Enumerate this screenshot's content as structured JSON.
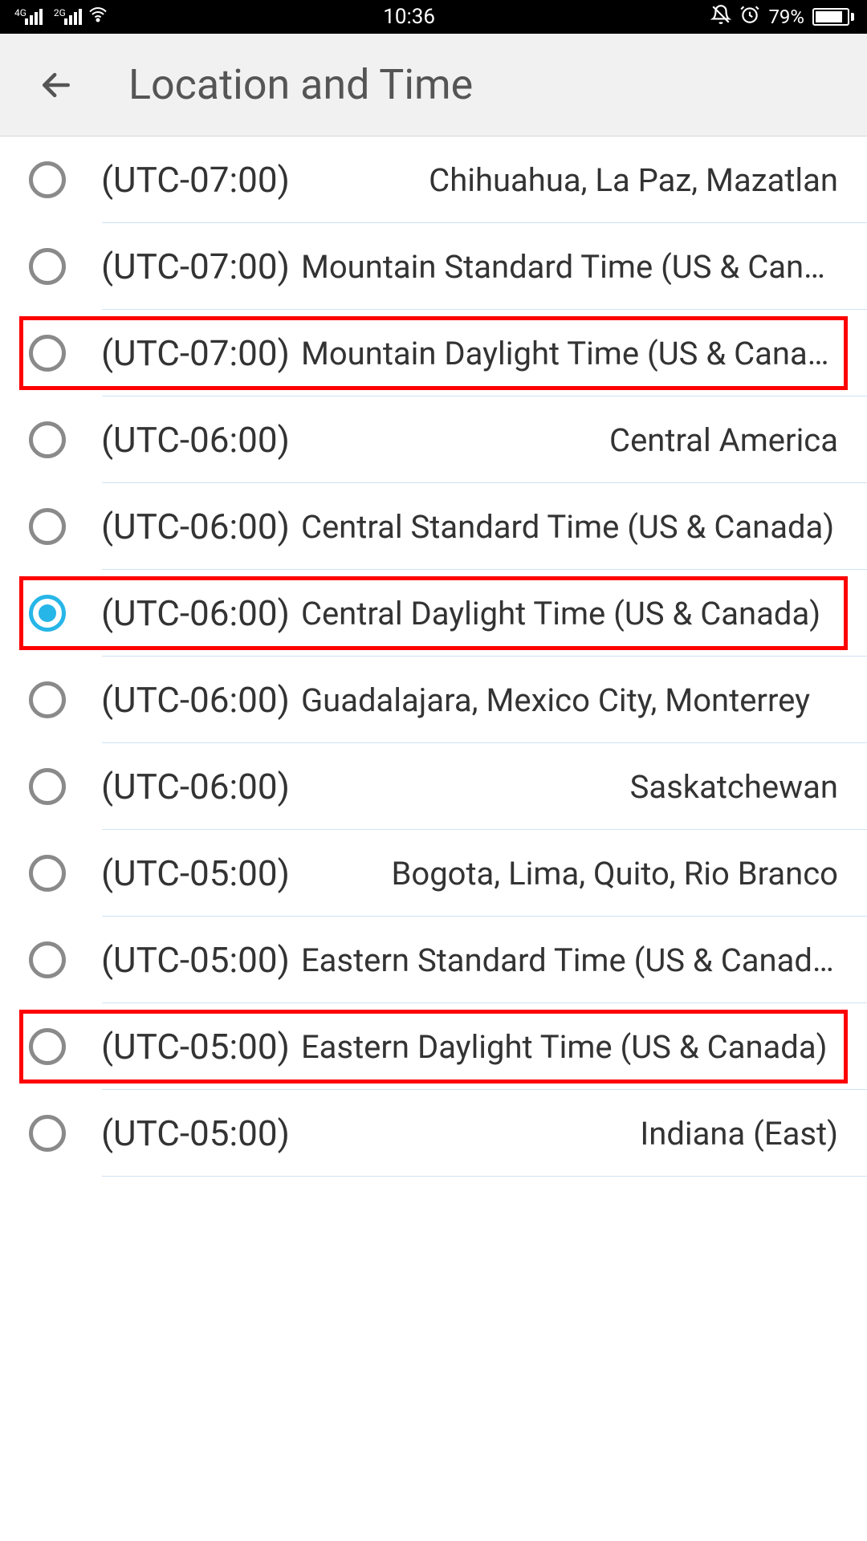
{
  "status_bar": {
    "signal1_label": "4G",
    "signal2_label": "2G",
    "time": "10:36",
    "battery_pct": "79%"
  },
  "header": {
    "title": "Location and Time"
  },
  "timezones": [
    {
      "offset": "(UTC-07:00)",
      "name": "Chihuahua, La Paz, Mazatlan",
      "selected": false,
      "long": false
    },
    {
      "offset": "(UTC-07:00)",
      "name": "Mountain Standard Time (US & Canada)",
      "selected": false,
      "long": true
    },
    {
      "offset": "(UTC-07:00)",
      "name": "Mountain Daylight Time (US & Canada)",
      "selected": false,
      "long": true,
      "highlighted": true
    },
    {
      "offset": "(UTC-06:00)",
      "name": "Central America",
      "selected": false,
      "long": false
    },
    {
      "offset": "(UTC-06:00)",
      "name": "Central Standard Time (US & Canada)",
      "selected": false,
      "long": true
    },
    {
      "offset": "(UTC-06:00)",
      "name": "Central Daylight Time (US & Canada)",
      "selected": true,
      "long": true,
      "highlighted": true
    },
    {
      "offset": "(UTC-06:00)",
      "name": "Guadalajara, Mexico City, Monterrey",
      "selected": false,
      "long": true
    },
    {
      "offset": "(UTC-06:00)",
      "name": "Saskatchewan",
      "selected": false,
      "long": false
    },
    {
      "offset": "(UTC-05:00)",
      "name": "Bogota, Lima, Quito, Rio Branco",
      "selected": false,
      "long": false
    },
    {
      "offset": "(UTC-05:00)",
      "name": "Eastern Standard Time (US & Canada)",
      "selected": false,
      "long": true
    },
    {
      "offset": "(UTC-05:00)",
      "name": "Eastern Daylight Time (US & Canada)",
      "selected": false,
      "long": true,
      "highlighted": true
    },
    {
      "offset": "(UTC-05:00)",
      "name": "Indiana (East)",
      "selected": false,
      "long": false
    }
  ]
}
